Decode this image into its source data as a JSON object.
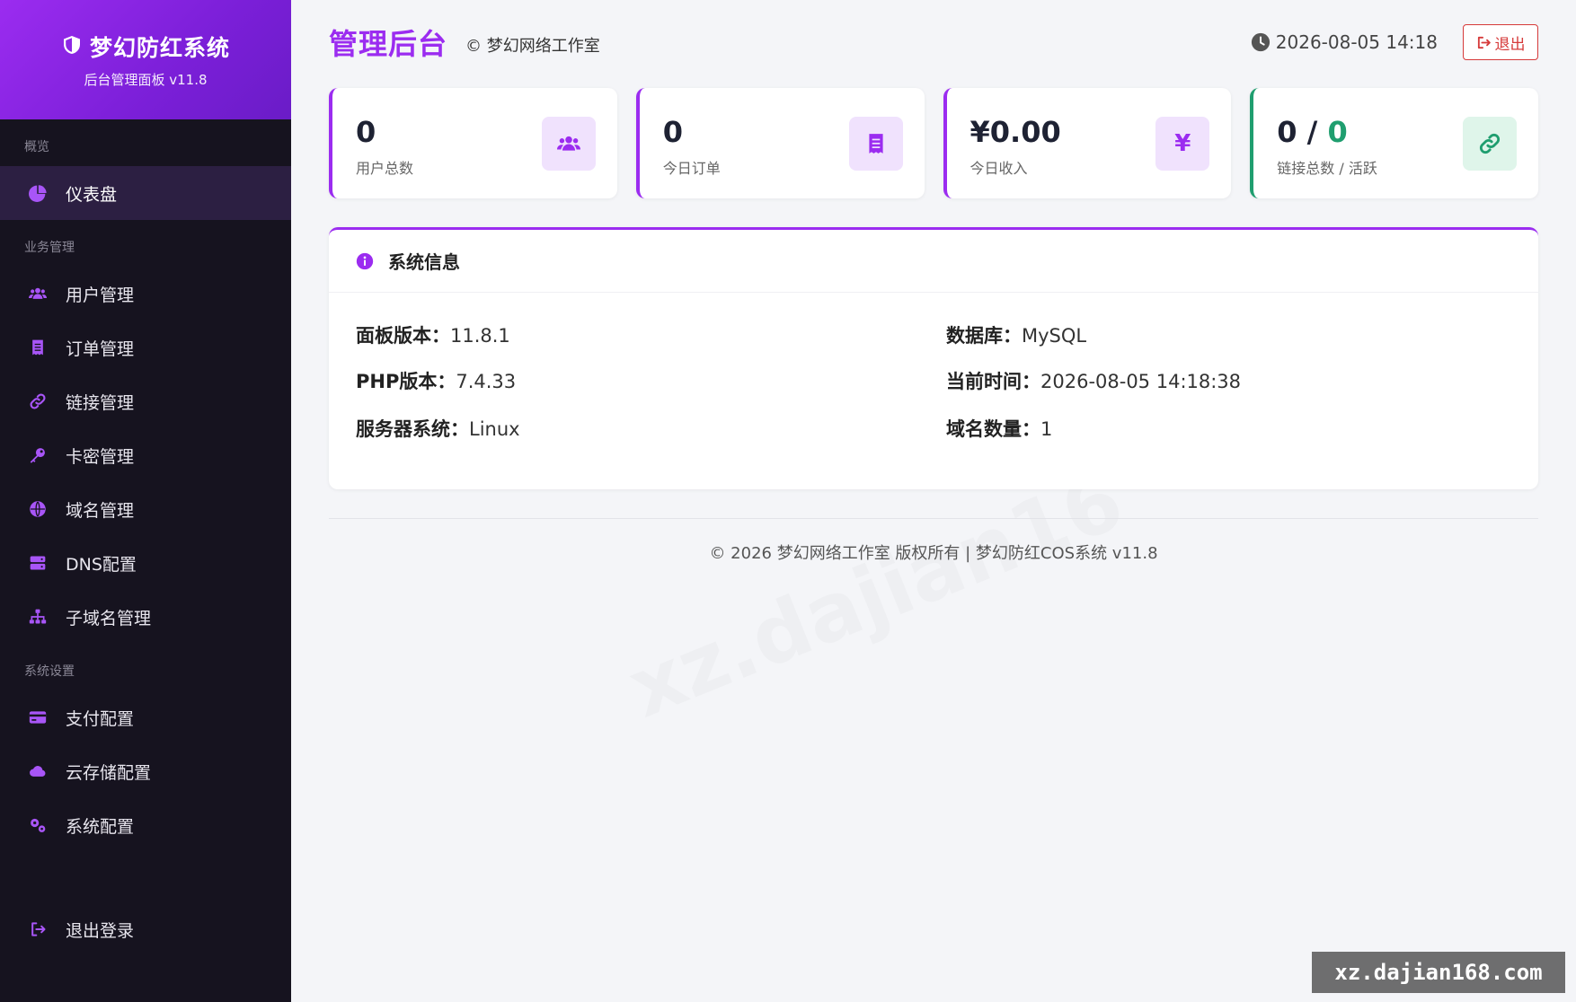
{
  "sidebar": {
    "brand_title": "梦幻防红系统",
    "brand_subtitle": "后台管理面板 v11.8",
    "sections": {
      "overview": "概览",
      "business": "业务管理",
      "settings": "系统设置"
    },
    "items": {
      "dashboard": "仪表盘",
      "users": "用户管理",
      "orders": "订单管理",
      "links": "链接管理",
      "cards": "卡密管理",
      "domains": "域名管理",
      "dns": "DNS配置",
      "subdomains": "子域名管理",
      "payment": "支付配置",
      "storage": "云存储配置",
      "system": "系统配置",
      "logout": "退出登录"
    }
  },
  "header": {
    "title": "管理后台",
    "subtitle": "© 梦幻网络工作室",
    "datetime": "2026-08-05 14:18",
    "logout_label": "退出"
  },
  "stats": {
    "users": {
      "value": "0",
      "label": "用户总数"
    },
    "orders": {
      "value": "0",
      "label": "今日订单"
    },
    "income": {
      "value": "¥0.00",
      "label": "今日收入"
    },
    "links": {
      "total": "0",
      "sep": " / ",
      "active": "0",
      "label": "链接总数 / 活跃"
    },
    "income_icon": "¥"
  },
  "system_info": {
    "title": "系统信息",
    "panel_version_label": "面板版本：",
    "panel_version": "11.8.1",
    "php_version_label": "PHP版本：",
    "php_version": "7.4.33",
    "os_label": "服务器系统：",
    "os": "Linux",
    "db_label": "数据库：",
    "db": "MySQL",
    "time_label": "当前时间：",
    "time": "2026-08-05 14:18:38",
    "domain_count_label": "域名数量：",
    "domain_count": "1"
  },
  "footer": {
    "text": "© 2026 梦幻网络工作室 版权所有 | 梦幻防红COS系统 v11.8"
  },
  "watermark": {
    "text": "xz.dajian168.com",
    "ghost": "xz.dajian16"
  },
  "colors": {
    "accent": "#9b2cf0",
    "sidebar_bg": "#16131f",
    "active_bg": "#2c1f42",
    "success": "#1f9e6f",
    "danger": "#d63a3a"
  }
}
